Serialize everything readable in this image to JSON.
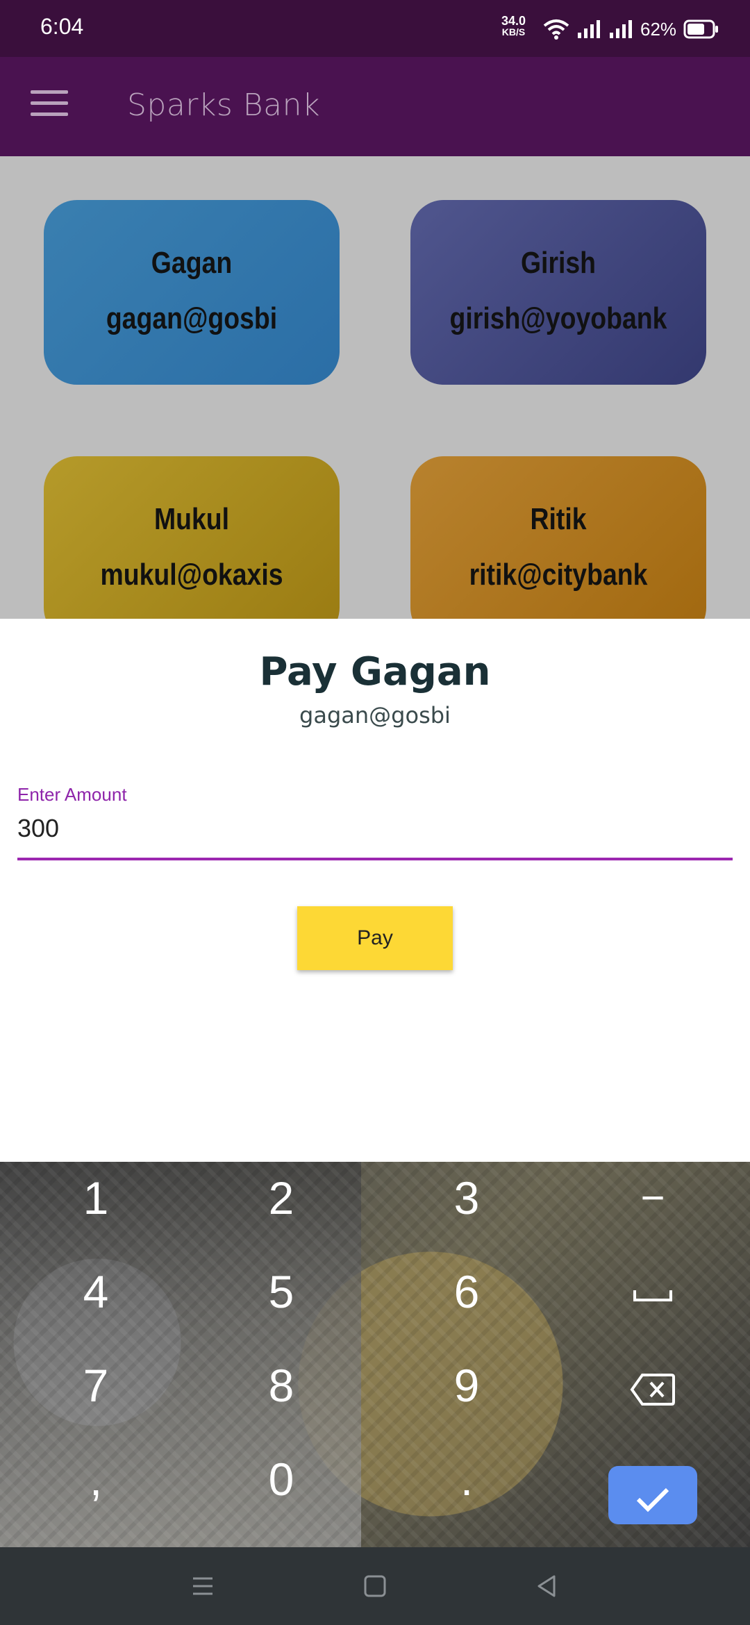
{
  "status_bar": {
    "time": "6:04",
    "net_speed": "34.0",
    "net_unit": "KB/S",
    "battery": "62%"
  },
  "app_bar": {
    "title": "Sparks Bank"
  },
  "contacts": [
    {
      "name": "Gagan",
      "upi": "gagan@gosbi",
      "color": "#3a7fb0"
    },
    {
      "name": "Girish",
      "upi": "girish@yoyobank",
      "color": "#50568e"
    },
    {
      "name": "Mukul",
      "upi": "mukul@okaxis",
      "color": "#b59a2a"
    },
    {
      "name": "Ritik",
      "upi": "ritik@citybank",
      "color": "#b8822e"
    }
  ],
  "pay_sheet": {
    "title": "Pay Gagan",
    "subtitle": "gagan@gosbi",
    "amount_label": "Enter Amount",
    "amount_value": "300",
    "pay_button": "Pay"
  },
  "keyboard": {
    "keys": [
      "1",
      "2",
      "3",
      "−",
      "4",
      "5",
      "6",
      "7",
      "8",
      "9",
      ",",
      "0",
      "."
    ],
    "space_icon": "space-icon",
    "backspace_icon": "backspace-icon",
    "enter_icon": "check-icon"
  },
  "nav_bar": {
    "icons": [
      "menu-icon",
      "home-icon",
      "back-icon"
    ]
  },
  "colors": {
    "primary": "#4a1250",
    "accent": "#9c27b0",
    "pay_button": "#fdd835",
    "enter_key": "#5b8def"
  }
}
